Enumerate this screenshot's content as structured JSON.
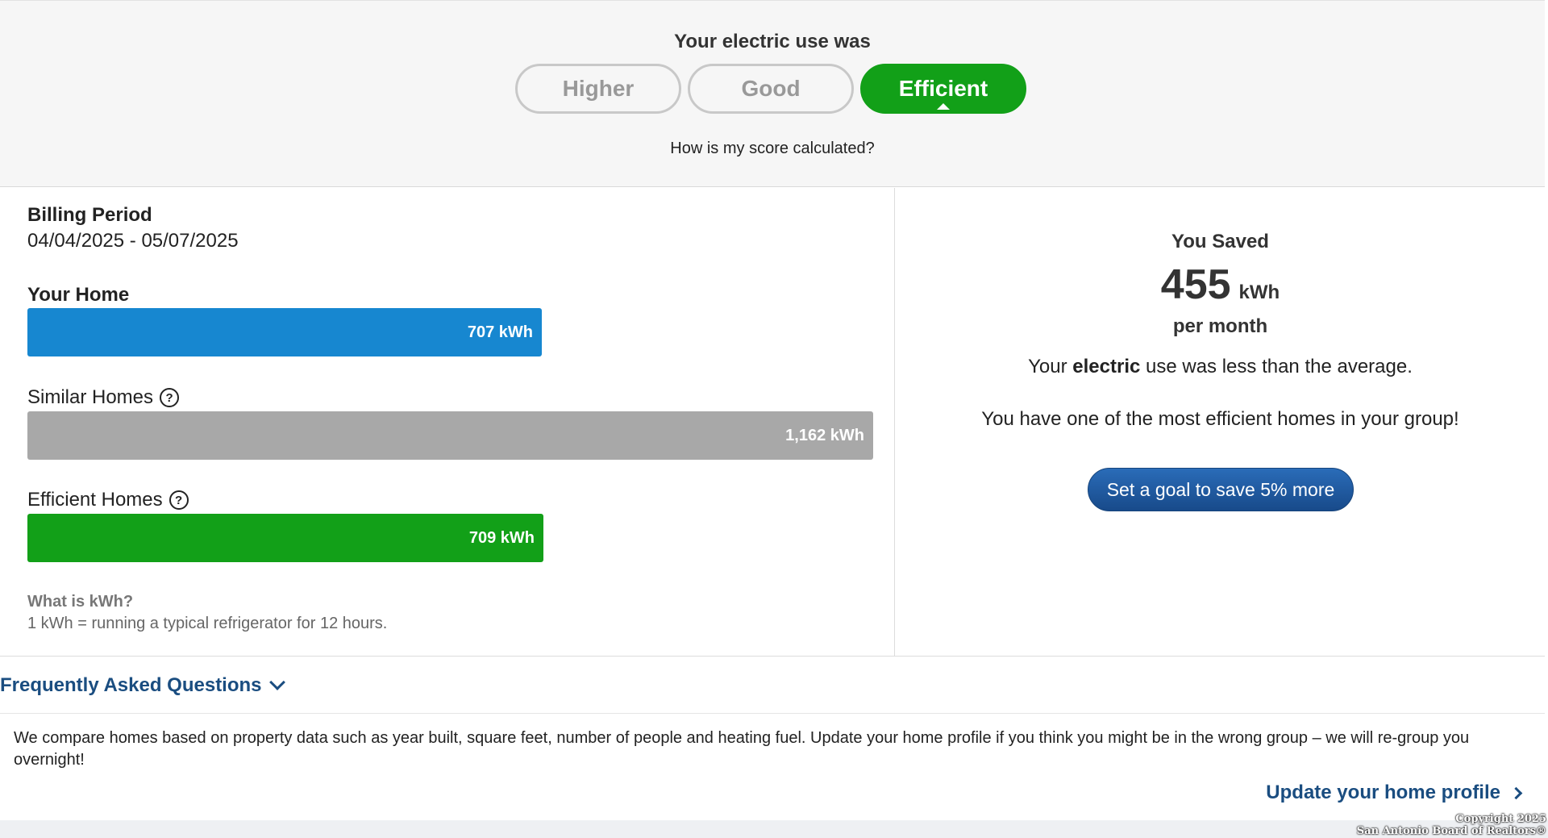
{
  "score": {
    "title": "Your electric use was",
    "options": [
      "Higher",
      "Good",
      "Efficient"
    ],
    "selected": "Efficient",
    "link": "How is my score calculated?"
  },
  "billing": {
    "label": "Billing Period",
    "dates": "04/04/2025 - 05/07/2025"
  },
  "comparison": {
    "max_kwh": 1162,
    "bars": [
      {
        "label": "Your Home",
        "value_text": "707 kWh",
        "kwh": 707,
        "color": "#1787d0",
        "help": false
      },
      {
        "label": "Similar Homes",
        "value_text": "1,162 kWh",
        "kwh": 1162,
        "color": "#a8a8a8",
        "help": true
      },
      {
        "label": "Efficient Homes",
        "value_text": "709 kWh",
        "kwh": 709,
        "color": "#12a018",
        "help": true
      }
    ]
  },
  "kwh_info": {
    "title": "What is kWh?",
    "desc": "1 kWh = running a typical refrigerator for 12 hours."
  },
  "savings": {
    "label": "You Saved",
    "value": "455",
    "unit": "kWh",
    "period": "per month",
    "msg_prefix": "Your ",
    "msg_bold": "electric",
    "msg_suffix": " use was less than the average.",
    "msg2": "You have one of the most efficient homes in your group!",
    "button": "Set a goal to save 5% more"
  },
  "faq": {
    "title": "Frequently Asked Questions",
    "text": "We compare homes based on property data such as year built, square feet, number of people and heating fuel. Update your home profile if you think you might be in the wrong group – we will re-group you overnight!",
    "link": "Update your home profile"
  },
  "watermark": {
    "line1": "Copyright 2025",
    "line2": "San Antonio Board of Realtors®"
  },
  "colors": {
    "accent_green": "#12a018",
    "accent_blue": "#1787d0",
    "link_blue": "#1a4d80"
  }
}
